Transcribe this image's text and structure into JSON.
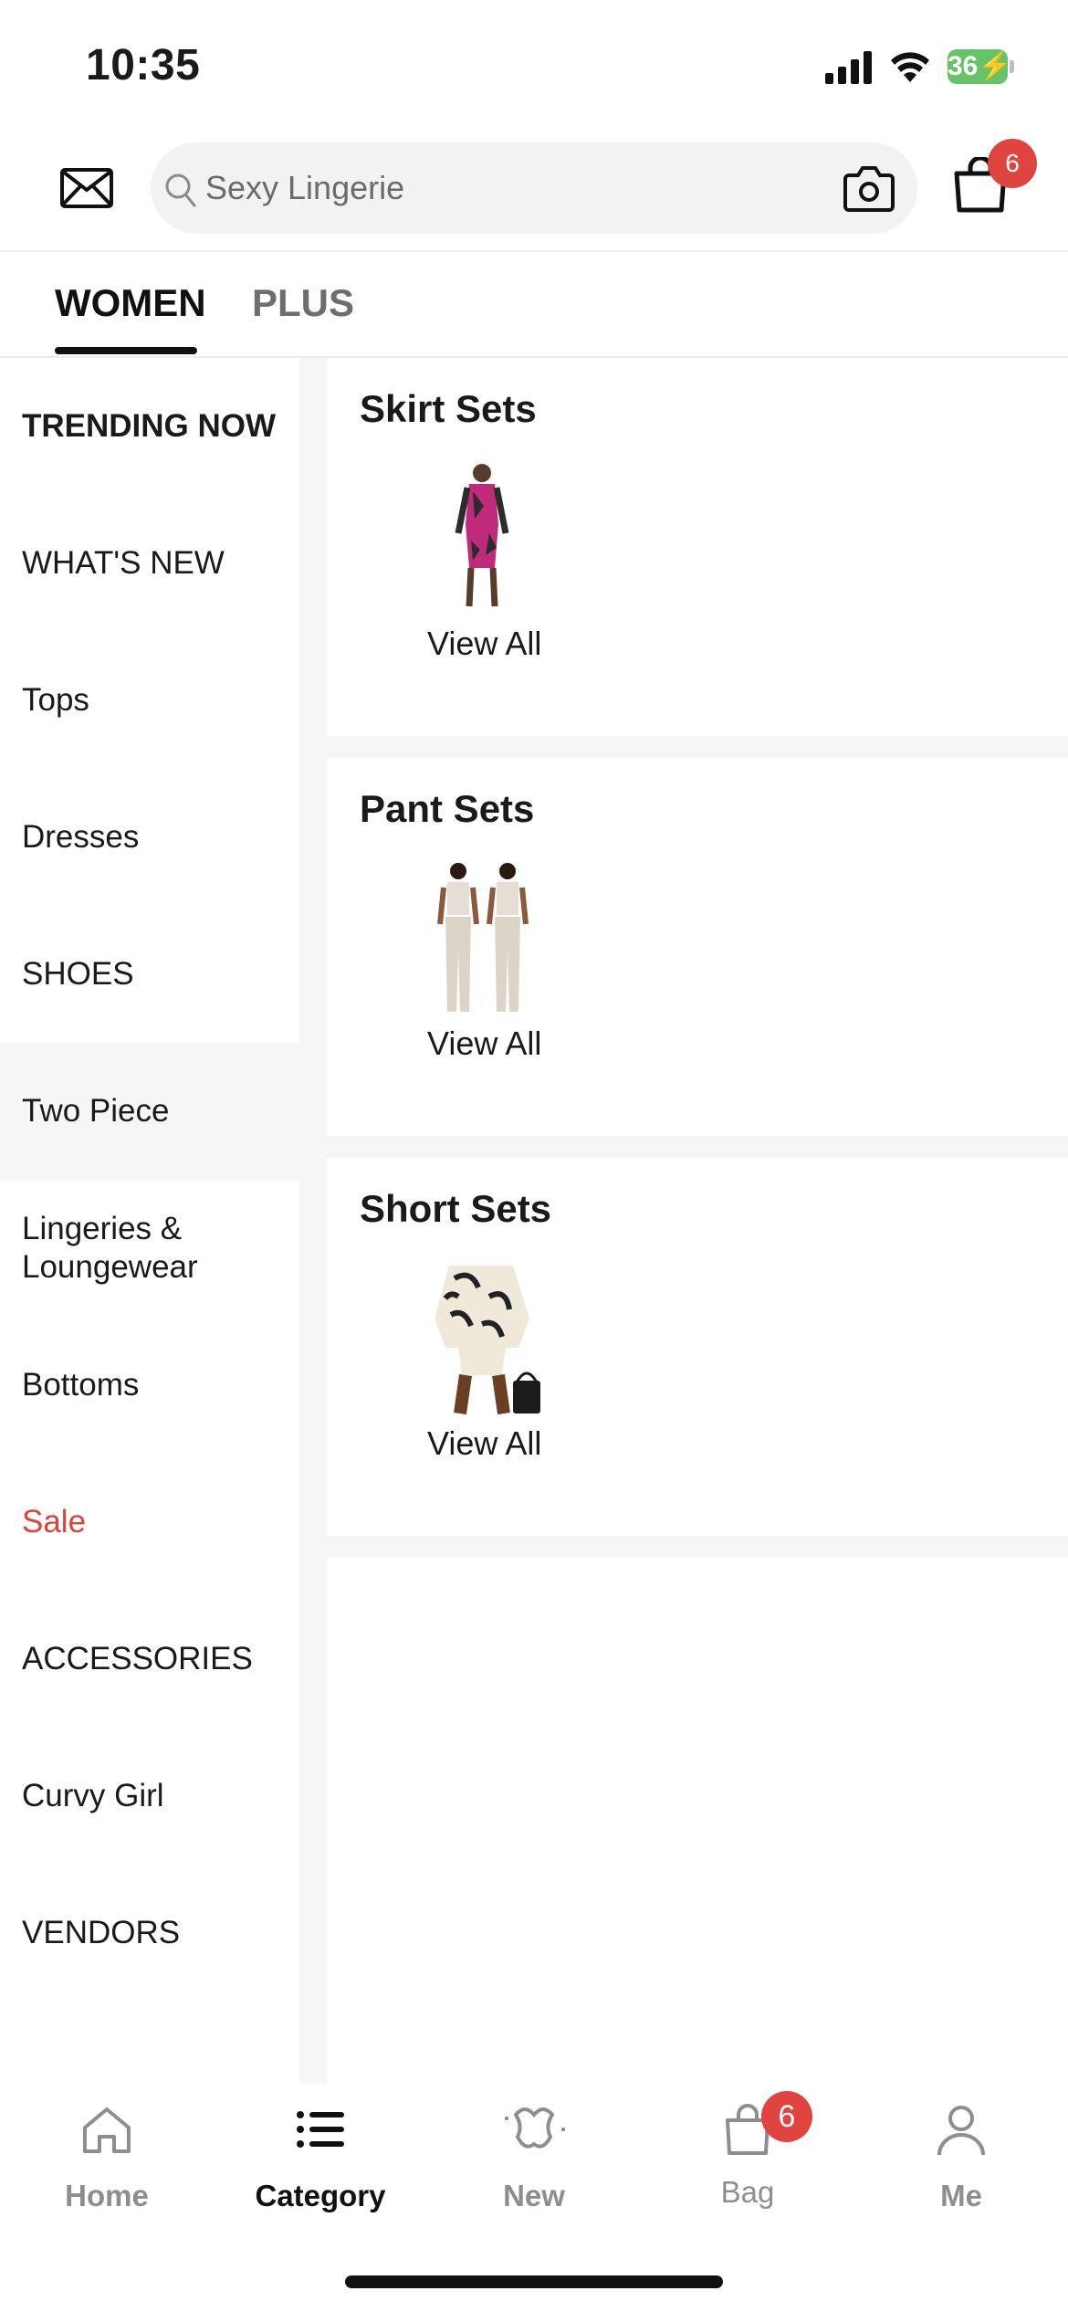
{
  "status_bar": {
    "time": "10:35",
    "battery": "36"
  },
  "header": {
    "search": {
      "placeholder": "Sexy Lingerie"
    },
    "cart_badge": "6"
  },
  "tabs": [
    {
      "label": "WOMEN",
      "active": true
    },
    {
      "label": "PLUS",
      "active": false
    }
  ],
  "sidebar": {
    "items": [
      {
        "label": "TRENDING NOW"
      },
      {
        "label": "WHAT'S NEW"
      },
      {
        "label": "Tops"
      },
      {
        "label": "Dresses"
      },
      {
        "label": "SHOES"
      },
      {
        "label": "Two Piece",
        "active": true
      },
      {
        "label": "Lingeries & Loungewear"
      },
      {
        "label": "Bottoms"
      },
      {
        "label": "Sale",
        "color": "#d9453d"
      },
      {
        "label": "ACCESSORIES"
      },
      {
        "label": "Curvy Girl"
      },
      {
        "label": "VENDORS"
      }
    ]
  },
  "sections": [
    {
      "title": "Skirt Sets",
      "link": "View All"
    },
    {
      "title": "Pant Sets",
      "link": "View All"
    },
    {
      "title": "Short Sets",
      "link": "View All"
    }
  ],
  "bottom_nav": {
    "items": [
      {
        "label": "Home",
        "icon": "home-icon"
      },
      {
        "label": "Category",
        "icon": "category-icon",
        "active": true
      },
      {
        "label": "New",
        "icon": "new-icon"
      },
      {
        "label": "Bag",
        "icon": "bag-icon",
        "badge": "6"
      },
      {
        "label": "Me",
        "icon": "profile-icon"
      }
    ]
  },
  "colors": {
    "accent_red": "#e0443e",
    "sale_red": "#d9453d",
    "battery_green": "#65c466"
  }
}
